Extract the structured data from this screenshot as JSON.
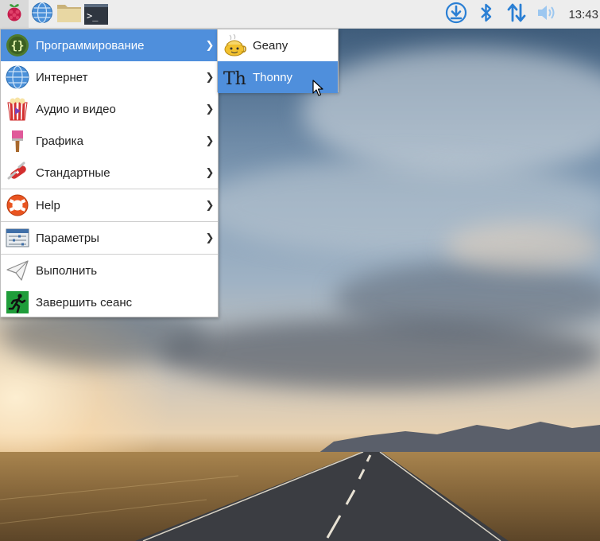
{
  "panel": {
    "launcher_icon": "raspberry-icon",
    "quick_launch": [
      {
        "name": "browser-icon"
      },
      {
        "name": "file-manager-icon"
      },
      {
        "name": "terminal-icon",
        "glyph": ">_"
      }
    ],
    "tray": [
      "updates-icon",
      "bluetooth-icon",
      "network-icon",
      "volume-icon"
    ],
    "clock": "13:43"
  },
  "menu": {
    "items": [
      {
        "label": "Программирование",
        "icon": "programming-icon",
        "submenu": true,
        "active": true
      },
      {
        "label": "Интернет",
        "icon": "internet-icon",
        "submenu": true
      },
      {
        "label": "Аудио и видео",
        "icon": "audio-video-icon",
        "submenu": true
      },
      {
        "label": "Графика",
        "icon": "graphics-icon",
        "submenu": true
      },
      {
        "label": "Стандартные",
        "icon": "accessories-icon",
        "submenu": true
      },
      {
        "label": "Help",
        "icon": "help-icon",
        "submenu": true
      },
      {
        "label": "Параметры",
        "icon": "preferences-icon",
        "submenu": true
      },
      {
        "label": "Выполнить",
        "icon": "run-icon",
        "submenu": false
      },
      {
        "label": "Завершить сеанс",
        "icon": "logout-icon",
        "submenu": false
      }
    ],
    "code_glyph": "{}"
  },
  "submenu": {
    "items": [
      {
        "label": "Geany",
        "icon": "geany-icon"
      },
      {
        "label": "Thonny",
        "icon": "thonny-icon",
        "active": true
      }
    ],
    "thonny_glyph": "Th"
  },
  "colors": {
    "highlight": "#4f8fdc",
    "panel_bg": "#ededed",
    "tray_blue": "#2a7fd4"
  }
}
